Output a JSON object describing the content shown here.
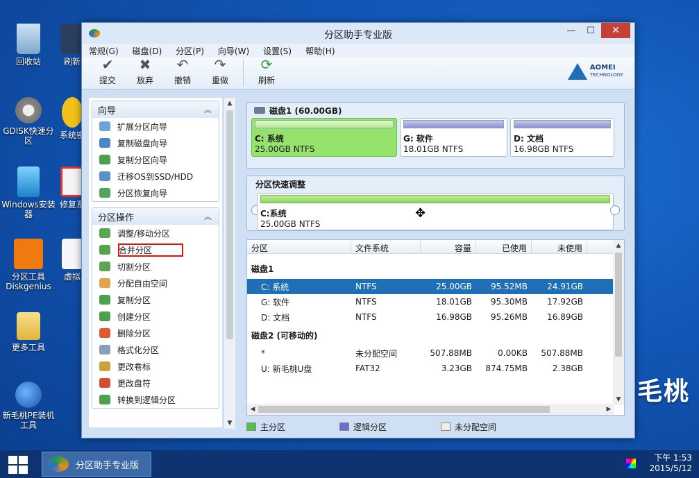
{
  "desktop": {
    "icons": [
      {
        "label": "回收站"
      },
      {
        "label": "刷新"
      },
      {
        "label": "GDISK快速分区"
      },
      {
        "label": "系统密"
      },
      {
        "label": "Windows安装器"
      },
      {
        "label": "修复系"
      },
      {
        "label": "分区工具Diskgenius"
      },
      {
        "label": "虚拟"
      },
      {
        "label": "更多工具"
      },
      {
        "label": "新毛桃PE装机工具"
      }
    ],
    "brand": "毛桃"
  },
  "window": {
    "title": "分区助手专业版",
    "minimize": "—",
    "maximize": "☐",
    "close": "✕"
  },
  "menu": [
    "常规(G)",
    "磁盘(D)",
    "分区(P)",
    "向导(W)",
    "设置(S)",
    "帮助(H)"
  ],
  "toolbar": {
    "submit": "提交",
    "discard": "放弃",
    "undo": "撤销",
    "redo": "重做",
    "refresh": "刷新"
  },
  "logo": {
    "name": "AOMEI",
    "sub": "TECHNOLOGY"
  },
  "wizard": {
    "title": "向导",
    "items": [
      "扩展分区向导",
      "复制磁盘向导",
      "复制分区向导",
      "迁移OS到SSD/HDD",
      "分区恢复向导"
    ]
  },
  "partition_ops": {
    "title": "分区操作",
    "items": [
      "调整/移动分区",
      "合并分区",
      "切割分区",
      "分配自由空间",
      "复制分区",
      "创建分区",
      "删除分区",
      "格式化分区",
      "更改卷标",
      "更改盘符",
      "转换到逻辑分区"
    ]
  },
  "disk_map": {
    "title": "磁盘1 (60.00GB)",
    "partitions": [
      {
        "name": "C: 系统",
        "info": "25.00GB NTFS"
      },
      {
        "name": "G: 软件",
        "info": "18.01GB NTFS"
      },
      {
        "name": "D: 文档",
        "info": "16.98GB NTFS"
      }
    ]
  },
  "quick_adjust": {
    "title": "分区快速调整",
    "name": "C:系统",
    "info": "25.00GB NTFS"
  },
  "table": {
    "headers": [
      "分区",
      "文件系统",
      "容量",
      "已使用",
      "未使用"
    ],
    "disk1_label": "磁盘1",
    "disk1_rows": [
      [
        "C: 系统",
        "NTFS",
        "25.00GB",
        "95.52MB",
        "24.91GB"
      ],
      [
        "G: 软件",
        "NTFS",
        "18.01GB",
        "95.30MB",
        "17.92GB"
      ],
      [
        "D: 文档",
        "NTFS",
        "16.98GB",
        "95.26MB",
        "16.89GB"
      ]
    ],
    "disk2_label": "磁盘2 (可移动的)",
    "disk2_rows": [
      [
        "*",
        "未分配空间",
        "507.88MB",
        "0.00KB",
        "507.88MB"
      ],
      [
        "U: 新毛桃U盘",
        "FAT32",
        "3.23GB",
        "874.75MB",
        "2.38GB"
      ]
    ]
  },
  "legend": [
    "主分区",
    "逻辑分区",
    "未分配空间"
  ],
  "taskbar": {
    "task": "分区助手专业版",
    "time": "下午 1:53",
    "date": "2015/5/12"
  },
  "colors": {
    "primary": "#8fe06a",
    "logical": "#8a8fd6",
    "unallocated": "#f2ede6",
    "selection": "#1e6fb5"
  }
}
